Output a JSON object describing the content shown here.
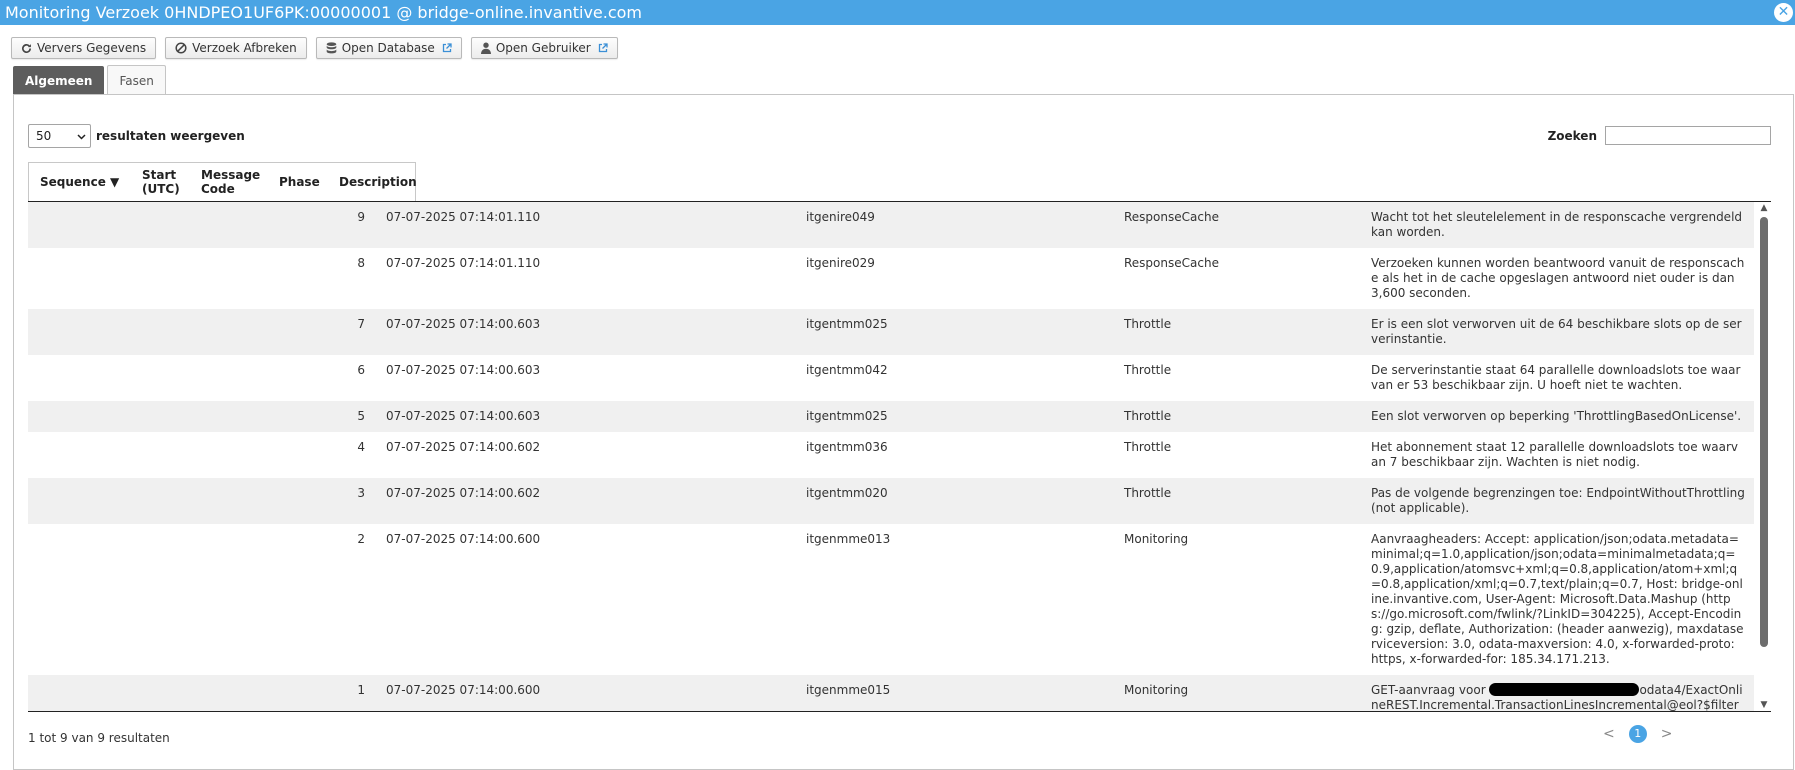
{
  "window": {
    "title": "Monitoring Verzoek 0HNDPEO1UF6PK:00000001 @ bridge-online.invantive.com",
    "close_label": "✕"
  },
  "toolbar": {
    "refresh_label": "Ververs Gegevens",
    "abort_label": "Verzoek Afbreken",
    "open_db_label": "Open Database",
    "open_user_label": "Open Gebruiker"
  },
  "tabs": [
    {
      "label": "Algemeen",
      "active": true
    },
    {
      "label": "Fasen",
      "active": false
    }
  ],
  "length_control": {
    "value": "50",
    "label": "resultaten weergeven"
  },
  "search": {
    "label": "Zoeken",
    "value": ""
  },
  "table": {
    "columns": [
      {
        "label": "Sequence ▼"
      },
      {
        "label": "Start (UTC)"
      },
      {
        "label": "Message Code"
      },
      {
        "label": "Phase"
      },
      {
        "label": "Description"
      }
    ],
    "rows": [
      {
        "seq": "9",
        "start": "07-07-2025 07:14:01.110",
        "code": "itgenire049",
        "phase": "ResponseCache",
        "desc": "Wacht tot het sleutelelement in de responscache vergrendeld kan worden."
      },
      {
        "seq": "8",
        "start": "07-07-2025 07:14:01.110",
        "code": "itgenire029",
        "phase": "ResponseCache",
        "desc": "Verzoeken kunnen worden beantwoord vanuit de responscache als het in de cache opgeslagen antwoord niet ouder is dan 3,600 seconden."
      },
      {
        "seq": "7",
        "start": "07-07-2025 07:14:00.603",
        "code": "itgentmm025",
        "phase": "Throttle",
        "desc": "Er is een slot verworven uit de 64 beschikbare slots op de serverinstantie."
      },
      {
        "seq": "6",
        "start": "07-07-2025 07:14:00.603",
        "code": "itgentmm042",
        "phase": "Throttle",
        "desc": "De serverinstantie staat 64 parallelle downloadslots toe waarvan er 53 beschikbaar zijn. U hoeft niet te wachten."
      },
      {
        "seq": "5",
        "start": "07-07-2025 07:14:00.603",
        "code": "itgentmm025",
        "phase": "Throttle",
        "desc": "Een slot verworven op beperking 'ThrottlingBasedOnLicense'."
      },
      {
        "seq": "4",
        "start": "07-07-2025 07:14:00.602",
        "code": "itgentmm036",
        "phase": "Throttle",
        "desc": "Het abonnement staat 12 parallelle downloadslots toe waarvan 7 beschikbaar zijn. Wachten is niet nodig."
      },
      {
        "seq": "3",
        "start": "07-07-2025 07:14:00.602",
        "code": "itgentmm020",
        "phase": "Throttle",
        "desc": "Pas de volgende begrenzingen toe: EndpointWithoutThrottling (not applicable)."
      },
      {
        "seq": "2",
        "start": "07-07-2025 07:14:00.600",
        "code": "itgenmme013",
        "phase": "Monitoring",
        "desc": "Aanvraagheaders: Accept: application/json;odata.metadata=minimal;q=1.0,application/json;odata=minimalmetadata;q=0.9,application/atomsvc+xml;q=0.8,application/atom+xml;q=0.8,application/xml;q=0.7,text/plain;q=0.7, Host: bridge-online.invantive.com, User-Agent: Microsoft.Data.Mashup (https://go.microsoft.com/fwlink/?LinkID=304225), Accept-Encoding: gzip, deflate, Authorization: (header aanwezig), maxdataserviceversion: 3.0, odata-maxversion: 4.0, x-forwarded-proto: https, x-forwarded-for: 185.34.171.213."
      },
      {
        "seq": "1",
        "start": "07-07-2025 07:14:00.600",
        "code": "itgenmme015",
        "phase": "Monitoring",
        "desc_prefix": "GET-aanvraag voor ",
        "desc_suffix": "odata4/ExactOnlineREST.Incremental.TransactionLinesIncremental@eol?$filter"
      }
    ]
  },
  "footer": {
    "info": "1 tot 9 van 9 resultaten",
    "prev": "<",
    "page": "1",
    "next": ">"
  },
  "colors": {
    "titlebar": "#4aa4e4",
    "active_tab": "#5d5d5d",
    "row_stripe": "#f0f0f0"
  }
}
